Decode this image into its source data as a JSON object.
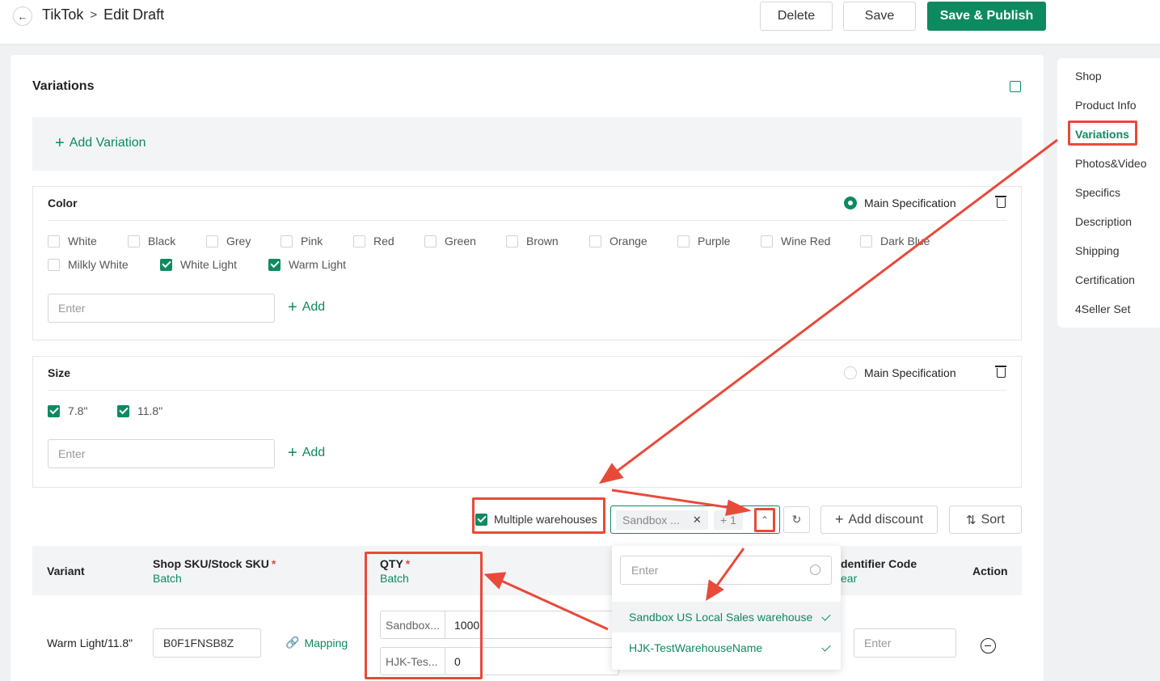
{
  "header": {
    "back_icon": "arrow-left-icon",
    "breadcrumb_root": "TikTok",
    "breadcrumb_sep": ">",
    "breadcrumb_current": "Edit Draft",
    "delete_label": "Delete",
    "save_label": "Save",
    "publish_label": "Save & Publish"
  },
  "variations": {
    "title": "Variations",
    "add_variation_label": "Add Variation"
  },
  "color_option": {
    "title": "Color",
    "main_spec_label": "Main Specification",
    "main_spec_selected": true,
    "values": [
      {
        "label": "White",
        "checked": false
      },
      {
        "label": "Black",
        "checked": false
      },
      {
        "label": "Grey",
        "checked": false
      },
      {
        "label": "Pink",
        "checked": false
      },
      {
        "label": "Red",
        "checked": false
      },
      {
        "label": "Green",
        "checked": false
      },
      {
        "label": "Brown",
        "checked": false
      },
      {
        "label": "Orange",
        "checked": false
      },
      {
        "label": "Purple",
        "checked": false
      },
      {
        "label": "Wine Red",
        "checked": false
      },
      {
        "label": "Dark Blue",
        "checked": false
      },
      {
        "label": "Milkly White",
        "checked": false
      },
      {
        "label": "White Light",
        "checked": true
      },
      {
        "label": "Warm Light",
        "checked": true
      }
    ],
    "input_placeholder": "Enter",
    "add_label": "Add"
  },
  "size_option": {
    "title": "Size",
    "main_spec_label": "Main Specification",
    "main_spec_selected": false,
    "values": [
      {
        "label": "7.8\"",
        "checked": true
      },
      {
        "label": "11.8\"",
        "checked": true
      }
    ],
    "input_placeholder": "Enter",
    "add_label": "Add"
  },
  "toolbar": {
    "multiple_warehouses_label": "Multiple warehouses",
    "multiple_warehouses_checked": true,
    "warehouse_tag": "Sandbox ...",
    "warehouse_more": "+ 1",
    "add_discount_label": "Add discount",
    "sort_label": "Sort"
  },
  "table": {
    "col_variant": "Variant",
    "col_sku": "Shop SKU/Stock SKU",
    "col_sku_sub": "Batch",
    "col_qty": "QTY",
    "col_qty_sub": "Batch",
    "col_identifier": "dentifier Code",
    "col_identifier_sub": "ear",
    "col_action": "Action",
    "required_mark": "*",
    "rows": [
      {
        "variant": "Warm Light/11.8\"",
        "sku": "B0F1FNSB8Z",
        "mapping_label": "Mapping",
        "qty": [
          {
            "warehouse": "Sandbox...",
            "value": "1000"
          },
          {
            "warehouse": "HJK-Tes...",
            "value": "0"
          }
        ],
        "identifier_placeholder": "Enter"
      }
    ]
  },
  "warehouse_dropdown": {
    "search_placeholder": "Enter",
    "options": [
      {
        "label": "Sandbox US Local Sales warehouse",
        "selected": true
      },
      {
        "label": "HJK-TestWarehouseName",
        "selected": true
      }
    ]
  },
  "right_nav": {
    "items": [
      "Shop",
      "Product Info",
      "Variations",
      "Photos&Video",
      "Specifics",
      "Description",
      "Shipping",
      "Certification",
      "4Seller Set"
    ],
    "active": "Variations"
  },
  "colors": {
    "accent": "#0e8a61",
    "annotation": "#e84a3a"
  }
}
